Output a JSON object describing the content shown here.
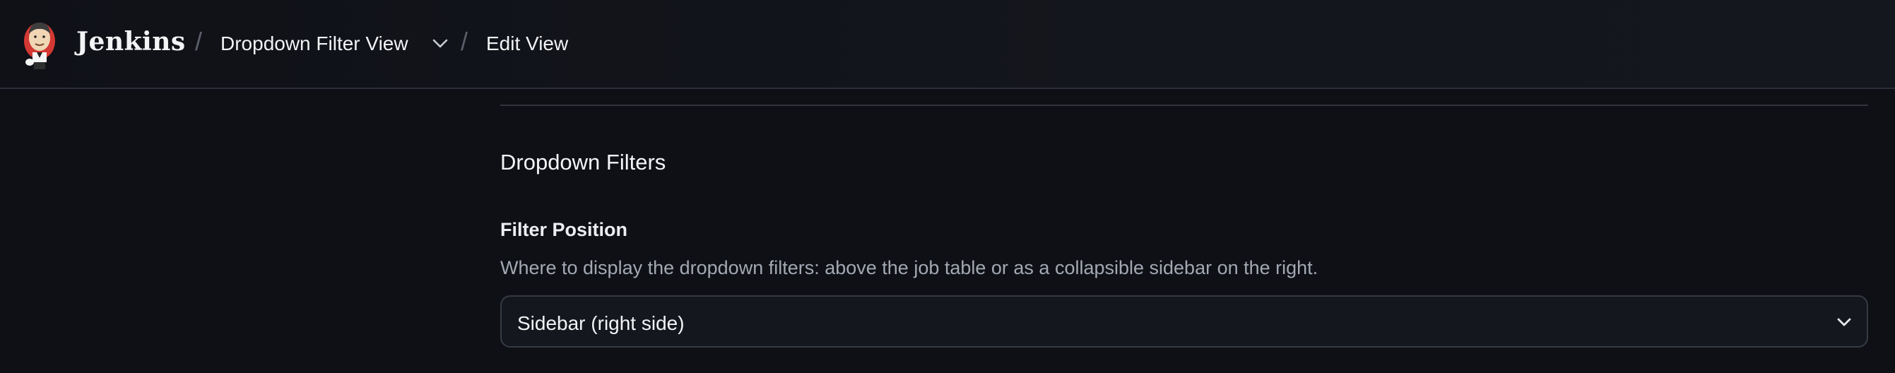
{
  "header": {
    "brand": "Jenkins",
    "separator": "/",
    "breadcrumb": [
      {
        "label": "Dropdown Filter View"
      },
      {
        "label": "Edit View"
      }
    ],
    "icons": {
      "logo": "jenkins-butler-logo",
      "crumb_menu": "chevron-down-icon"
    }
  },
  "main": {
    "section_title": "Dropdown Filters",
    "filter_position": {
      "label": "Filter Position",
      "description": "Where to display the dropdown filters: above the job table or as a collapsible sidebar on the right.",
      "selected_value": "Sidebar (right side)"
    }
  },
  "colors": {
    "background": "#0e1016",
    "header_bg": "#14161d",
    "muted_text": "#a3a8b3",
    "border": "#363a43"
  }
}
